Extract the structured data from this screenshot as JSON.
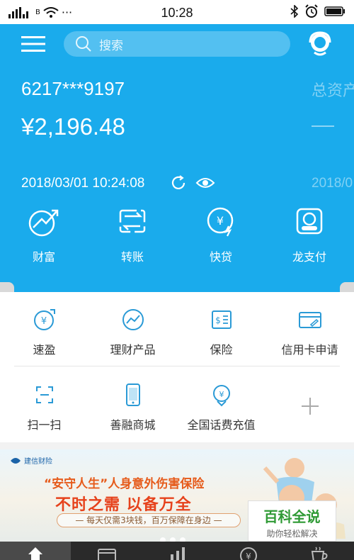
{
  "status_bar": {
    "carrier_label": "ıl ıl",
    "network_badge": "B",
    "more_dots": "···",
    "time": "10:28"
  },
  "header": {
    "search_placeholder": "搜索"
  },
  "account": {
    "card_number": "6217***9197",
    "balance": "¥2,196.48",
    "updated_at": "2018/03/01 10:24:08",
    "total_assets_label": "总资产",
    "second_date": "2018/0"
  },
  "quick_actions": [
    {
      "label": "财富",
      "icon": "wealth-icon"
    },
    {
      "label": "转账",
      "icon": "transfer-icon"
    },
    {
      "label": "快贷",
      "icon": "quick-loan-icon"
    },
    {
      "label": "龙支付",
      "icon": "long-pay-icon"
    }
  ],
  "services": [
    {
      "label": "速盈",
      "icon": "yuan-coin-icon"
    },
    {
      "label": "理财产品",
      "icon": "trend-icon"
    },
    {
      "label": "保险",
      "icon": "insurance-icon"
    },
    {
      "label": "信用卡申请",
      "icon": "credit-card-icon"
    },
    {
      "label": "扫一扫",
      "icon": "scan-icon"
    },
    {
      "label": "善融商城",
      "icon": "phone-mall-icon"
    },
    {
      "label": "全国话费充值",
      "icon": "phone-recharge-icon"
    },
    {
      "label": "",
      "icon": "add-icon"
    }
  ],
  "banner": {
    "logo_text": "建信财险",
    "title": "“安守人生”人身意外伤害保险",
    "slogan": "不时之需 以备万全",
    "subtitle": "— 每天仅需3块钱，百万保障在身边 —"
  },
  "watermark": {
    "main": "百科全说",
    "sub": "助你轻松解决"
  },
  "tabs": [
    {
      "name": "home-icon"
    },
    {
      "name": "card-icon"
    },
    {
      "name": "chart-icon"
    },
    {
      "name": "yuan-icon"
    },
    {
      "name": "cup-icon"
    }
  ],
  "colors": {
    "primary_blue": "#1aabec",
    "tabbar_bg": "#2a2a2a",
    "icon_blue": "#2a9ad6"
  }
}
